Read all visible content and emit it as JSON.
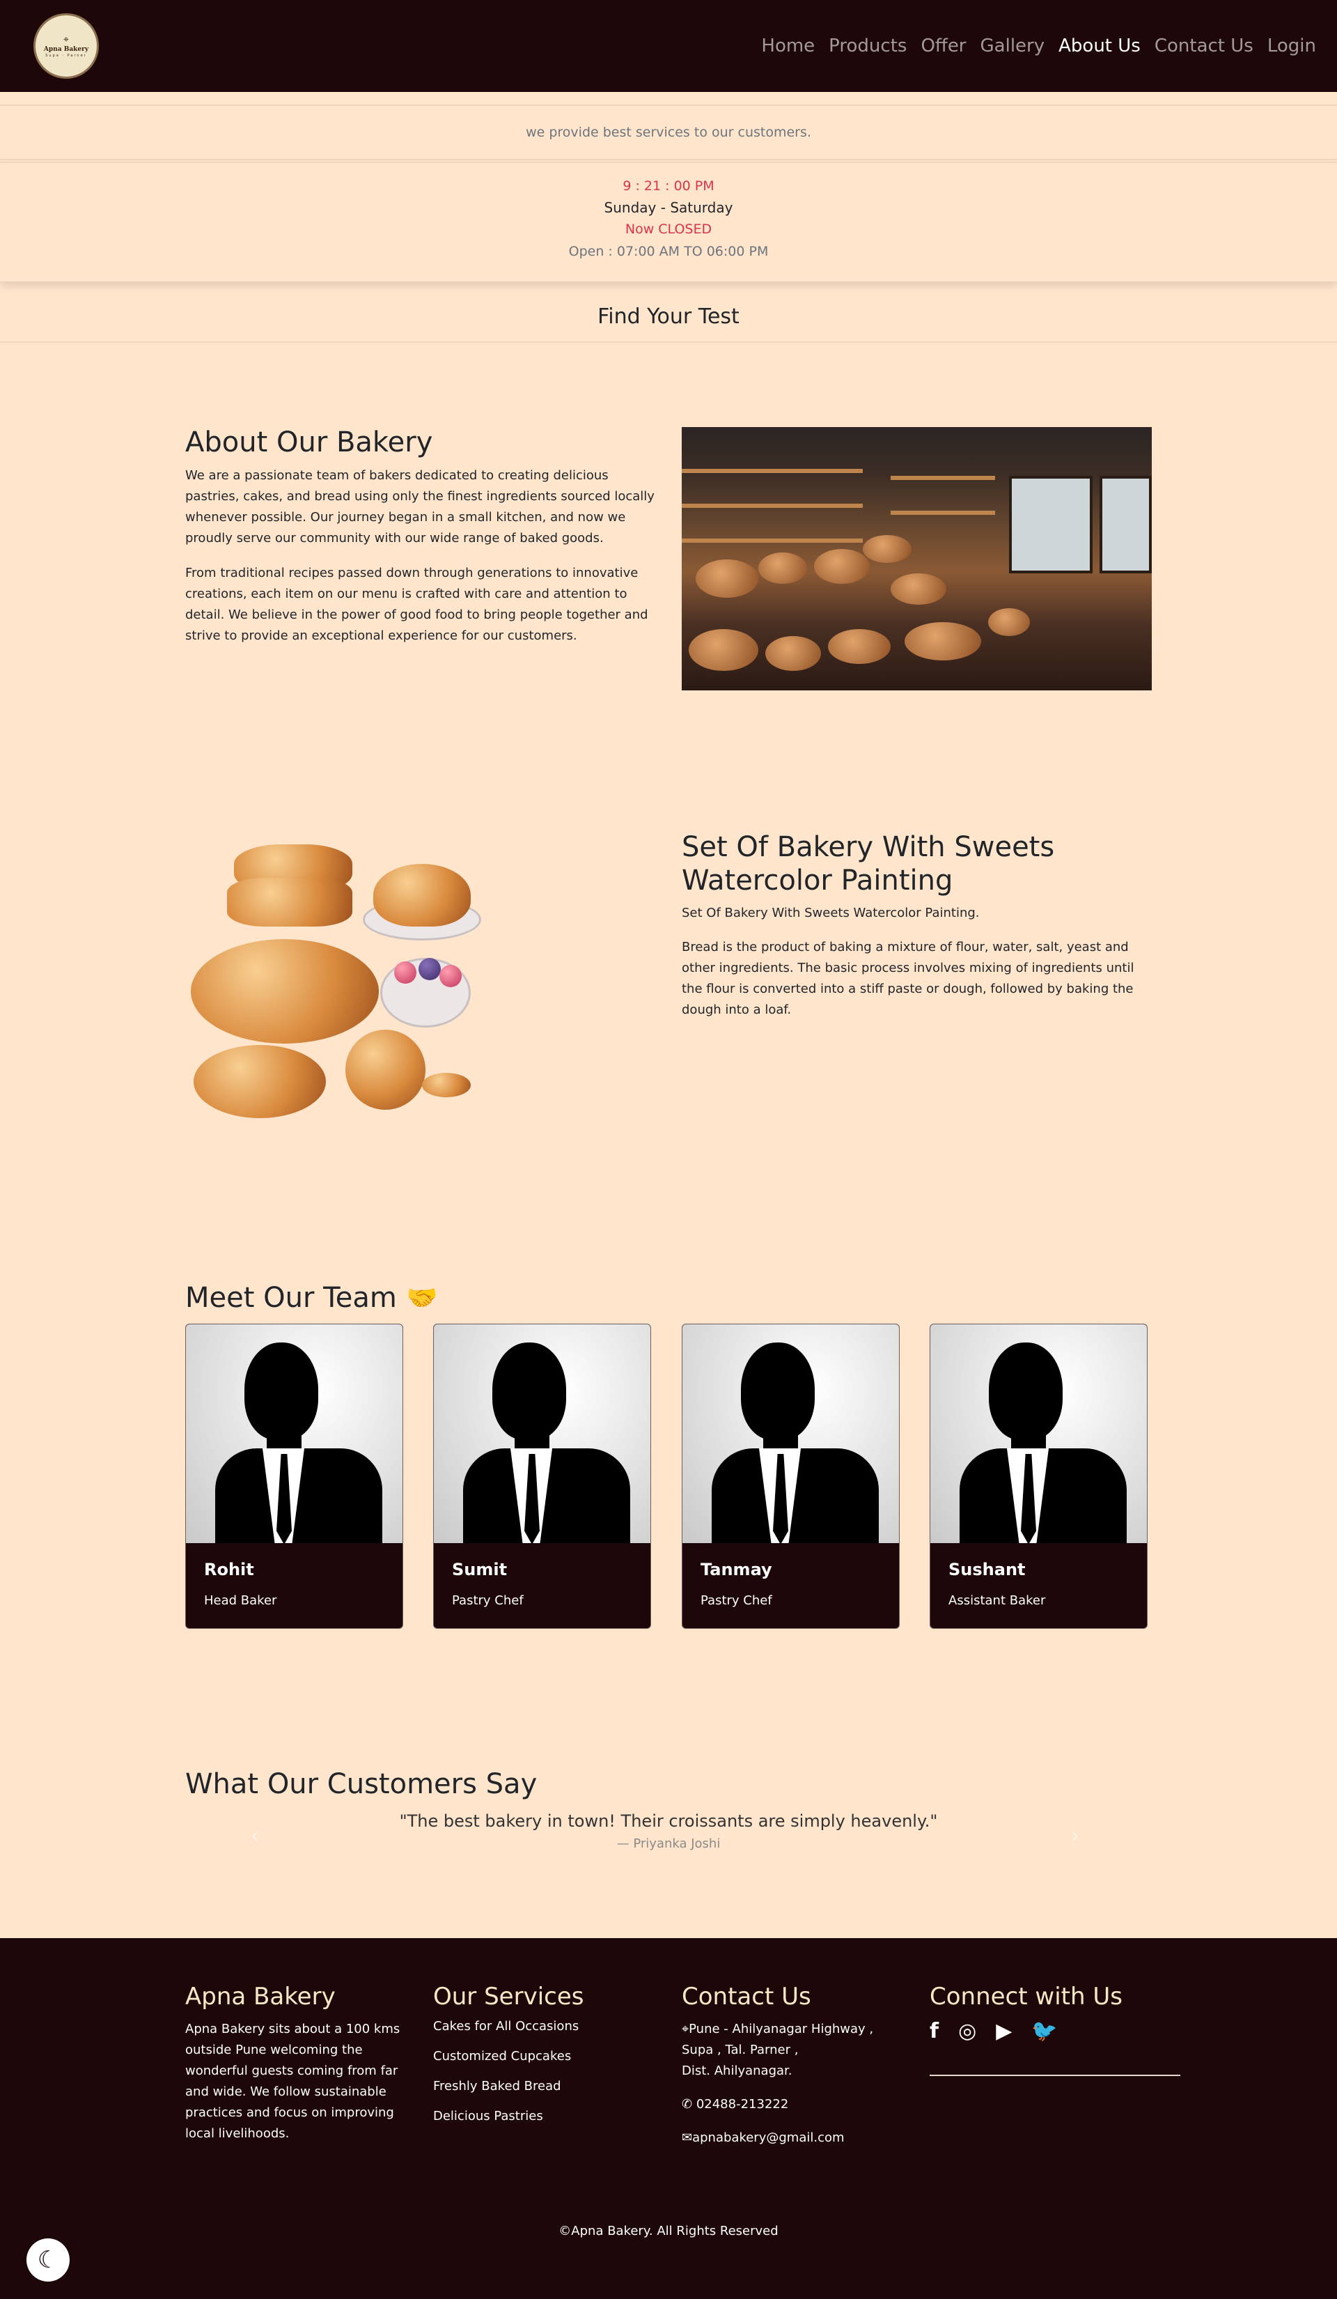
{
  "nav": {
    "logo": {
      "name": "Apna Bakery",
      "sub": "Supa · Parner"
    },
    "links": [
      "Home",
      "Products",
      "Offer",
      "Gallery",
      "About Us",
      "Contact Us",
      "Login"
    ]
  },
  "info": {
    "tagline": "we provide best services to our customers.",
    "clock": "9 : 21 : 00 PM",
    "days": "Sunday - Saturday",
    "status": "Now CLOSED",
    "hours": "Open : 07:00 AM TO 06:00 PM"
  },
  "find_title": "Find Your Test",
  "about": {
    "title": "About Our Bakery",
    "p1": "We are a passionate team of bakers dedicated to creating delicious pastries, cakes, and bread using only the finest ingredients sourced locally whenever possible. Our journey began in a small kitchen, and now we proudly serve our community with our wide range of baked goods.",
    "p2": "From traditional recipes passed down through generations to innovative creations, each item on our menu is crafted with care and attention to detail. We believe in the power of good food to bring people together and strive to provide an exceptional experience for our customers."
  },
  "painting": {
    "title": "Set Of Bakery With Sweets Watercolor Painting",
    "subtitle": "Set Of Bakery With Sweets Watercolor Painting.",
    "text": "Bread is the product of baking a mixture of flour, water, salt, yeast and other ingredients. The basic process involves mixing of ingredients until the flour is converted into a stiff paste or dough, followed by baking the dough into a loaf."
  },
  "team": {
    "title": "Meet Our Team",
    "icon": "handshake-icon",
    "members": [
      {
        "name": "Rohit",
        "role": "Head Baker"
      },
      {
        "name": "Sumit",
        "role": "Pastry Chef"
      },
      {
        "name": "Tanmay",
        "role": "Pastry Chef"
      },
      {
        "name": "Sushant",
        "role": "Assistant Baker"
      }
    ]
  },
  "testimonials": {
    "title": "What Our Customers Say",
    "quote": "\"The best bakery in town! Their croissants are simply heavenly.\"",
    "author": "— Priyanka Joshi"
  },
  "footer": {
    "about_title": "Apna Bakery",
    "about_text": "Apna Bakery sits about a 100 kms outside Pune welcoming the wonderful guests coming from far and wide. We follow sustainable practices and focus on improving local livelihoods.",
    "services_title": "Our Services",
    "services": [
      "Cakes for All Occasions",
      "Customized Cupcakes",
      "Freshly Baked Bread",
      "Delicious Pastries"
    ],
    "contact_title": "Contact Us",
    "address": [
      "Pune - Ahilyanagar Highway ,",
      "Supa , Tal. Parner ,",
      "Dist. Ahilyanagar."
    ],
    "phone": "02488-213222",
    "email": "apnabakery@gmail.com",
    "connect_title": "Connect with Us",
    "social": [
      "facebook-icon",
      "instagram-icon",
      "youtube-icon",
      "twitter-icon"
    ],
    "copyright": "©Apna Bakery. All Rights Reserved"
  },
  "colors": {
    "nav_bg": "#1e0708",
    "page_bg": "#ffe5cc",
    "closed_red": "#dc3545",
    "footer_heading": "#f7e8c6"
  }
}
